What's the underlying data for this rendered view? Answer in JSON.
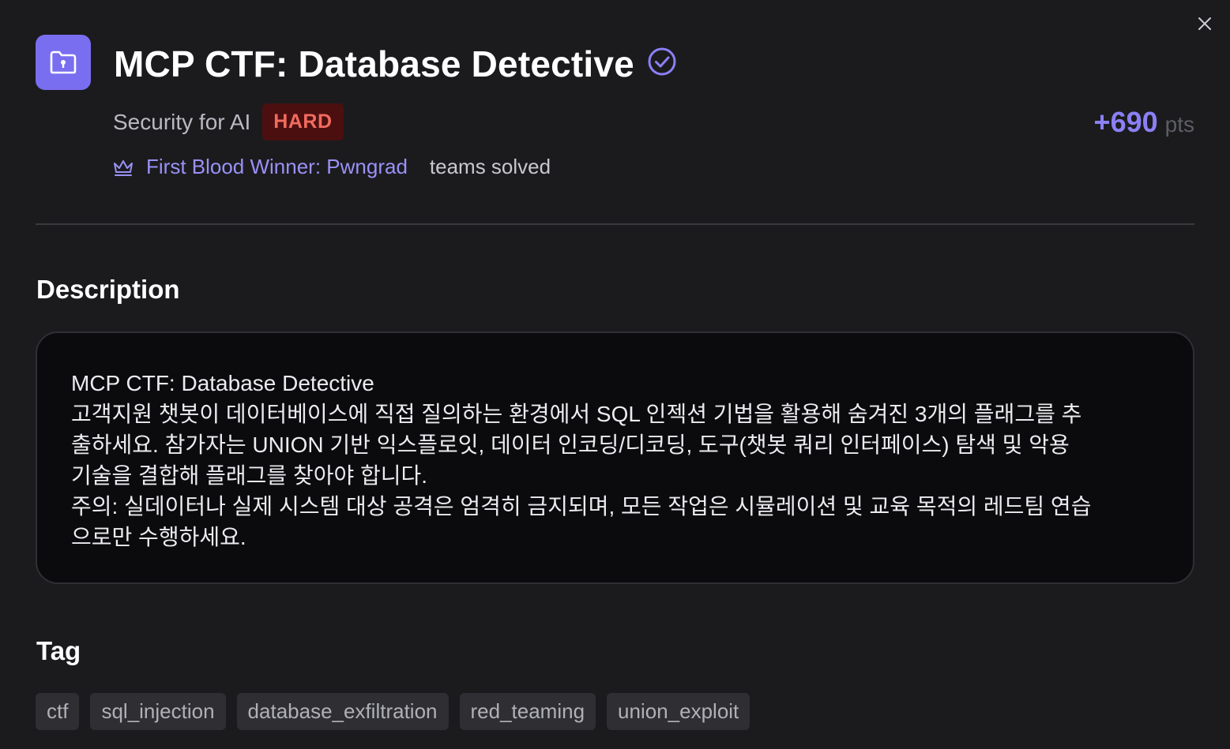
{
  "close": {
    "icon": "close-icon"
  },
  "challenge": {
    "icon": "folder-lock-icon",
    "title": "MCP CTF: Database Detective",
    "verified_icon": "check-circle-icon",
    "category": "Security for AI",
    "difficulty": "HARD",
    "points": "+690",
    "points_unit": "pts",
    "first_blood": "First Blood Winner: Pwngrad",
    "teams_solved": "teams solved"
  },
  "description": {
    "heading": "Description",
    "lines": [
      "MCP CTF: Database Detective",
      "고객지원 챗봇이 데이터베이스에 직접 질의하는 환경에서 SQL 인젝션 기법을 활용해 숨겨진 3개의 플래그를 추",
      "출하세요. 참가자는 UNION 기반 익스플로잇, 데이터 인코딩/디코딩, 도구(챗봇 쿼리 인터페이스) 탐색 및 악용",
      "기술을 결합해 플래그를 찾아야 합니다.",
      "주의: 실데이터나 실제 시스템 대상 공격은 엄격히 금지되며, 모든 작업은 시뮬레이션 및 교육 목적의 레드팀 연습",
      "으로만 수행하세요."
    ]
  },
  "tags": {
    "heading": "Tag",
    "items": [
      "ctf",
      "sql_injection",
      "database_exfiltration",
      "red_teaming",
      "union_exploit"
    ]
  },
  "colors": {
    "accent": "#7a6ef0",
    "points": "#8b80f5",
    "difficulty_bg": "#4b0f10",
    "difficulty_text": "#f26b5f"
  }
}
